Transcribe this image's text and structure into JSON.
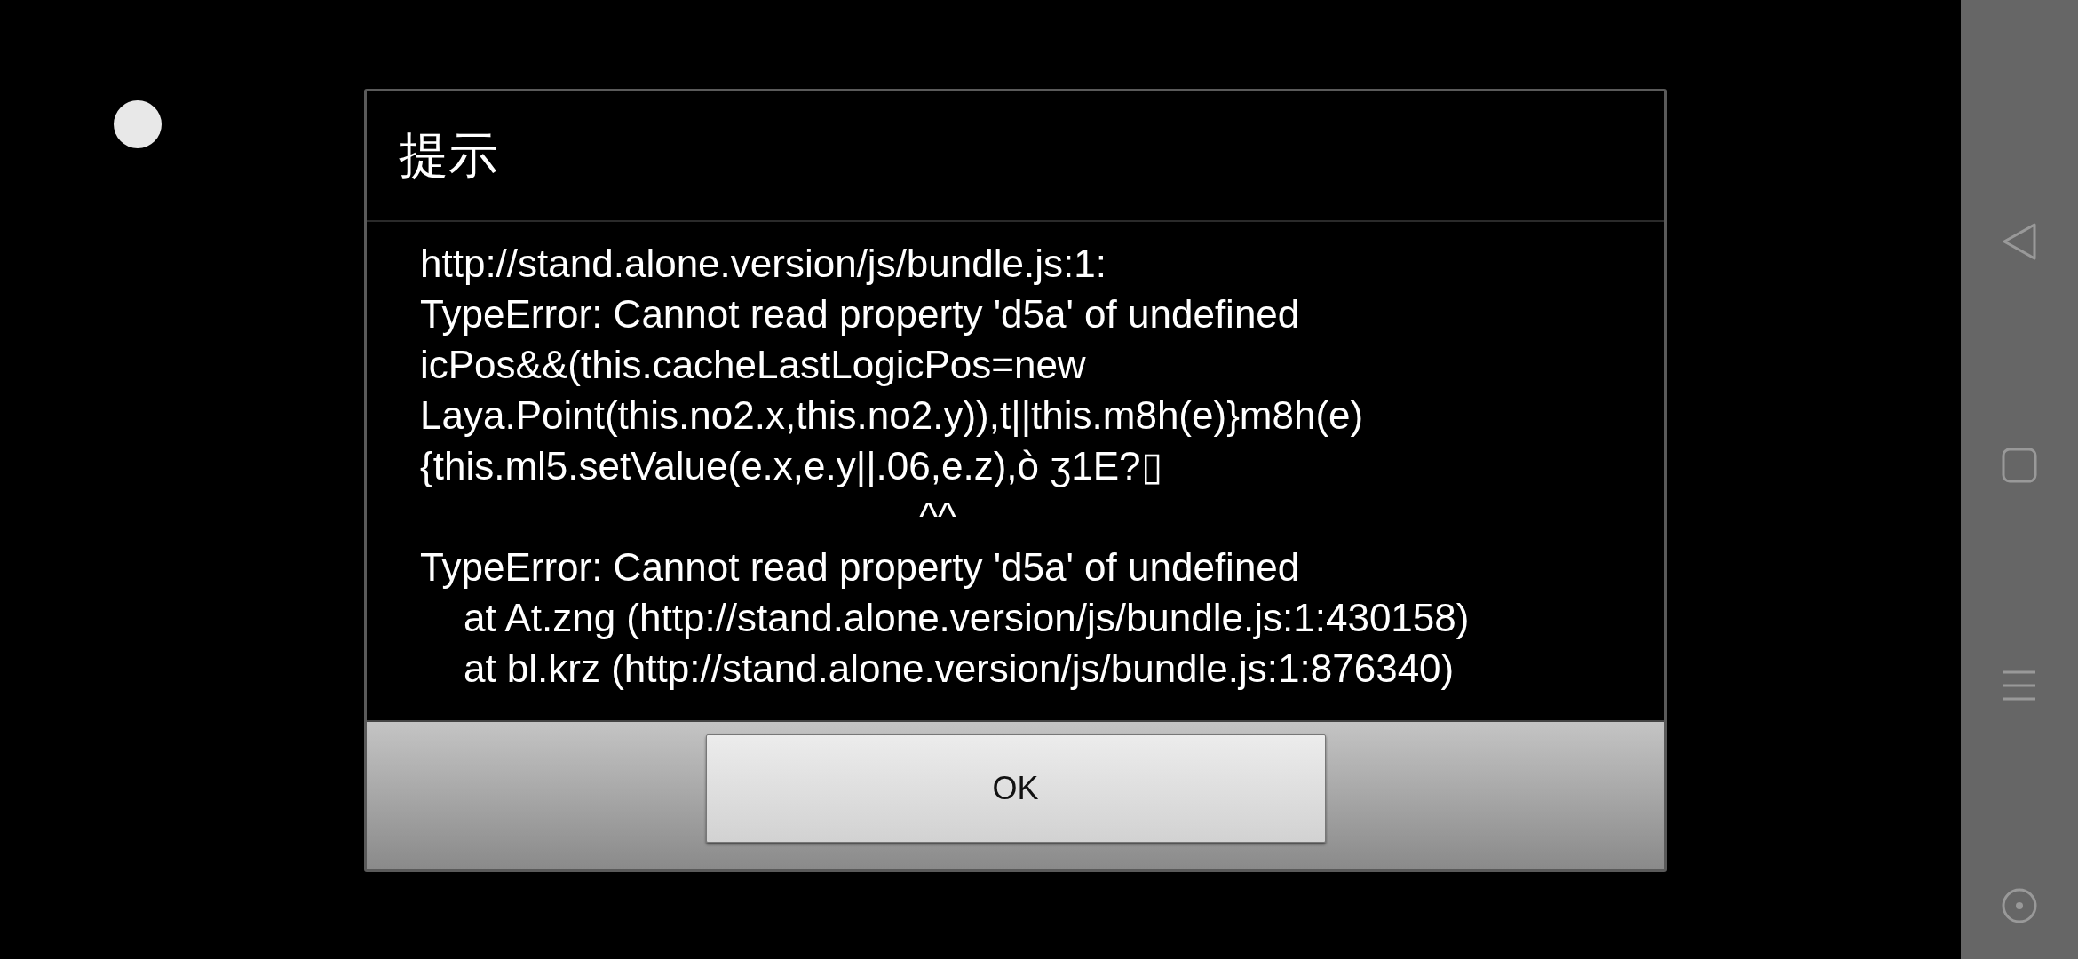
{
  "dialog": {
    "title": "提示",
    "message_lines": [
      "http://stand.alone.version/js/bundle.js:1:",
      "TypeError: Cannot read property 'd5a' of undefined",
      "icPos&&(this.cacheLastLogicPos=new",
      "Laya.Point(this.no2.x,this.no2.y)),t||this.m8h(e)}m8h(e)",
      "{this.ml5.setValue(e.x,e.y||.06,e.z),ò ʒ1E?▯",
      "                                              ^^",
      "TypeError: Cannot read property 'd5a' of undefined",
      "    at At.zng (http://stand.alone.version/js/bundle.js:1:430158)",
      "    at bl.krz (http://stand.alone.version/js/bundle.js:1:876340)"
    ],
    "buttons": [
      "OK"
    ]
  }
}
